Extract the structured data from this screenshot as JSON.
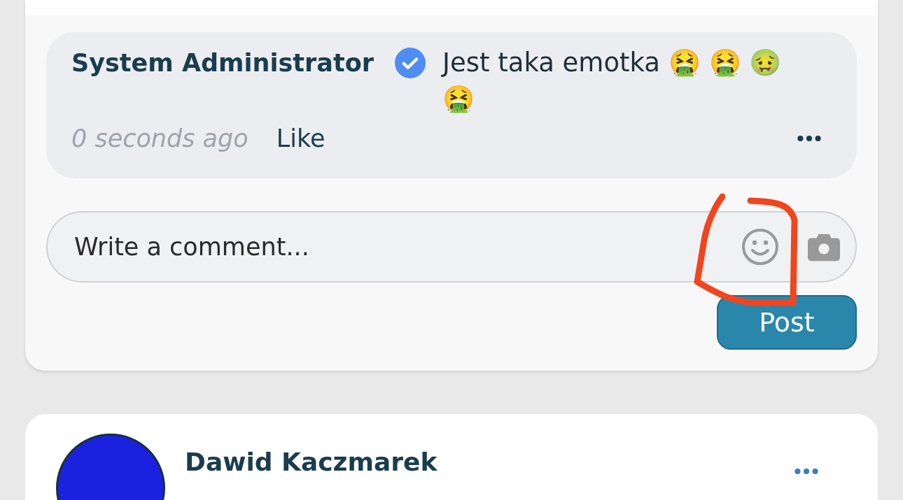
{
  "comment": {
    "author": "System Administrator",
    "verified": true,
    "text": "Jest taka emotka 🤮 🤮 🤢 🤮",
    "time": "0 seconds ago",
    "like": "Like"
  },
  "composer": {
    "placeholder": "Write a comment...",
    "post_button": "Post"
  },
  "next_post": {
    "author": "Dawid Kaczmarek"
  }
}
